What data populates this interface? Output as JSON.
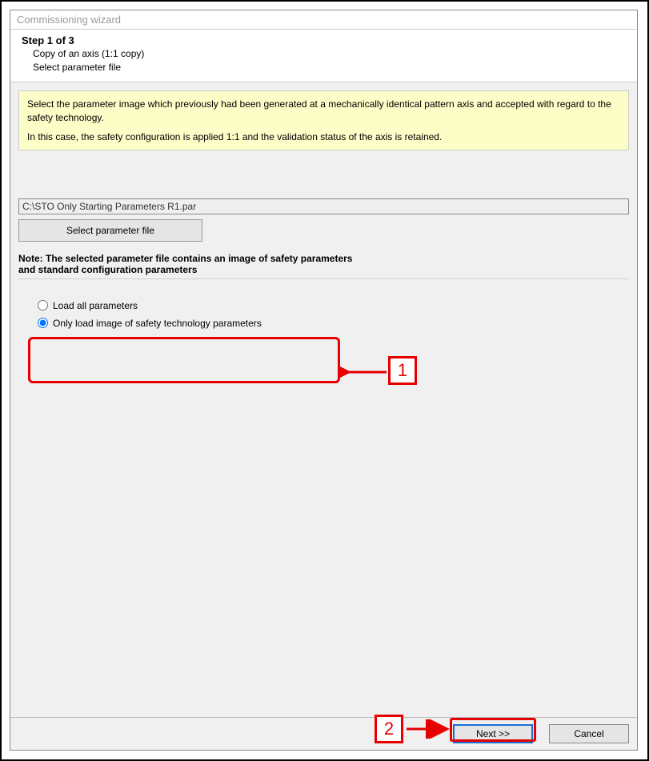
{
  "window": {
    "title": "Commissioning wizard"
  },
  "step": {
    "title": "Step 1 of 3",
    "sub1": "Copy of an axis (1:1 copy)",
    "sub2": "Select parameter file"
  },
  "info": {
    "p1": "Select the parameter image which previously had been generated at a mechanically identical pattern axis and accepted with regard to the safety technology.",
    "p2": "In this case, the safety configuration is applied 1:1 and the validation status of the axis is retained."
  },
  "file": {
    "path": "C:\\STO Only Starting Parameters R1.par",
    "select_button": "Select parameter file"
  },
  "note": {
    "line1": "Note: The selected parameter file contains an image of safety parameters",
    "line2": "and standard configuration parameters"
  },
  "radios": {
    "opt1": "Load all parameters",
    "opt2": "Only load image of safety technology parameters"
  },
  "footer": {
    "next": "Next >>",
    "cancel": "Cancel"
  },
  "annotations": {
    "callout1": "1",
    "callout2": "2"
  }
}
